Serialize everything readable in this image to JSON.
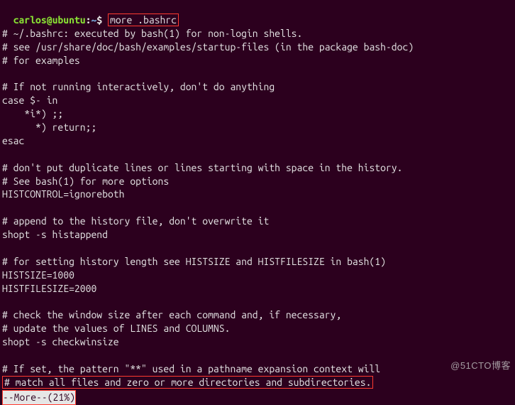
{
  "prompt": {
    "user_host": "carlos@ubuntu",
    "colon": ":",
    "path": "~",
    "symbol": "$"
  },
  "command": "more .bashrc",
  "lines": [
    "# ~/.bashrc: executed by bash(1) for non-login shells.",
    "# see /usr/share/doc/bash/examples/startup-files (in the package bash-doc)",
    "# for examples",
    "",
    "# If not running interactively, don't do anything",
    "case $- in",
    "    *i*) ;;",
    "      *) return;;",
    "esac",
    "",
    "# don't put duplicate lines or lines starting with space in the history.",
    "# See bash(1) for more options",
    "HISTCONTROL=ignoreboth",
    "",
    "# append to the history file, don't overwrite it",
    "shopt -s histappend",
    "",
    "# for setting history length see HISTSIZE and HISTFILESIZE in bash(1)",
    "HISTSIZE=1000",
    "HISTFILESIZE=2000",
    "",
    "# check the window size after each command and, if necessary,",
    "# update the values of LINES and COLUMNS.",
    "shopt -s checkwinsize",
    "",
    "# If set, the pattern \"**\" used in a pathname expansion context will"
  ],
  "highlighted_line": "# match all files and zero or more directories and subdirectories.",
  "more_status": "--More--(21%)",
  "watermark": "@51CTO博客"
}
